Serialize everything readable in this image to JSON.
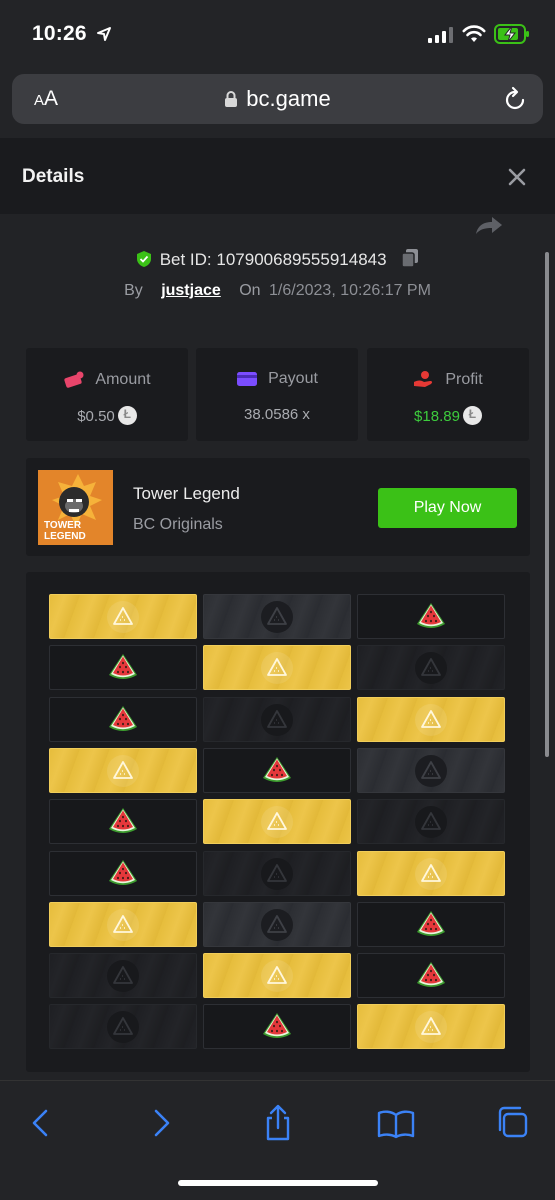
{
  "status": {
    "time": "10:26"
  },
  "browser": {
    "aa_label": "AA",
    "url": "bc.game"
  },
  "modal": {
    "title": "Details",
    "bet_id_label": "Bet ID:",
    "bet_id": "107900689555914843",
    "by_label": "By",
    "username": "justjace",
    "on_label": "On",
    "datetime": "1/6/2023, 10:26:17 PM"
  },
  "stats": {
    "amount": {
      "label": "Amount",
      "value": "$0.50"
    },
    "payout": {
      "label": "Payout",
      "value": "38.0586 x"
    },
    "profit": {
      "label": "Profit",
      "value": "$18.89"
    }
  },
  "game": {
    "name": "Tower Legend",
    "provider": "BC Originals",
    "thumb_text_line1": "TOWER",
    "thumb_text_line2": "LEGEND",
    "play_label": "Play Now"
  },
  "board": {
    "rows": [
      [
        "gold-cone",
        "gray-cone",
        "dark-melon"
      ],
      [
        "dark-melon",
        "gold-cone",
        "dim-cone"
      ],
      [
        "dark-melon",
        "dim-cone",
        "gold-cone"
      ],
      [
        "gold-cone",
        "dark-melon",
        "gray-cone"
      ],
      [
        "dark-melon",
        "gold-cone",
        "dim-cone"
      ],
      [
        "dark-melon",
        "dim-cone",
        "gold-cone"
      ],
      [
        "gold-cone",
        "gray-cone",
        "dark-melon"
      ],
      [
        "dim-cone",
        "gold-cone",
        "dark-melon"
      ],
      [
        "dim-cone",
        "dark-melon",
        "gold-cone"
      ]
    ]
  },
  "colors": {
    "accent_green": "#3bc117",
    "profit_green": "#3dcc3d",
    "gold_tile": "#e6bd3c",
    "amount_icon": "#e8456b",
    "payout_icon": "#7b4dff",
    "profit_icon": "#e53935"
  },
  "icons": {
    "toolbar": [
      "back-icon",
      "forward-icon",
      "share-icon",
      "bookmarks-icon",
      "tabs-icon"
    ]
  }
}
